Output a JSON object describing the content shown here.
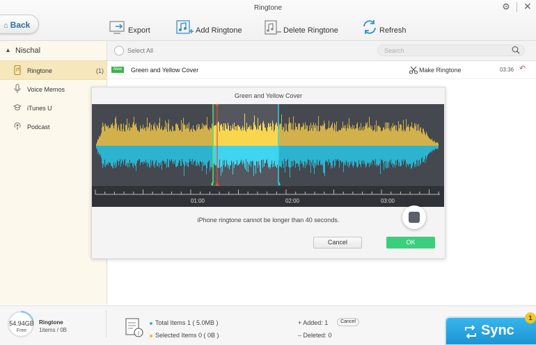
{
  "window": {
    "title": "Ringtone"
  },
  "toolbar": {
    "back_label": "Back",
    "export_label": "Export",
    "add_ringtone_label": "Add Ringtone",
    "delete_ringtone_label": "Delete Ringtone",
    "refresh_label": "Refresh"
  },
  "sidebar": {
    "device_name": "Nischal",
    "items": [
      {
        "label": "Ringtone",
        "count": "(1)",
        "icon": "phone-icon",
        "active": true
      },
      {
        "label": "Voice Memos",
        "count": "",
        "icon": "microphone-icon",
        "active": false
      },
      {
        "label": "iTunes U",
        "count": "",
        "icon": "graduation-cap-icon",
        "active": false
      },
      {
        "label": "Podcast",
        "count": "",
        "icon": "podcast-icon",
        "active": false
      }
    ]
  },
  "list": {
    "select_all_label": "Select All",
    "search_placeholder": "Search",
    "rows": [
      {
        "badge": "New",
        "title": "Green and Yellow Cover",
        "action_label": "Make Ringtone",
        "duration": "03:36"
      }
    ]
  },
  "dialog": {
    "title": "Green and Yellow Cover",
    "message": "iPhone ringtone cannot be longer than 40 seconds.",
    "cancel_label": "Cancel",
    "ok_label": "OK",
    "timeline_labels": [
      "01:00",
      "02:00",
      "03:00"
    ],
    "colors": {
      "wave_top": "#d3b14a",
      "wave_top_selected": "#f8d74e",
      "wave_bottom": "#2bb3cf",
      "wave_bottom_selected": "#3fd4f0",
      "start_marker": "#5bdc6a",
      "playhead": "#e0503e",
      "end_marker": "#2fd0e6"
    }
  },
  "footer": {
    "storage_size": "54.94GB",
    "storage_free_label": "Free",
    "category": "Ringtone",
    "category_count": "1items / 0B",
    "total_items": "Total Items 1 ( 5.0MB )",
    "selected_items": "Selected Items 0 ( 0B )",
    "added": "Added: 1",
    "added_cancel_label": "Cancel",
    "deleted": "Deleted: 0",
    "sync_label": "Sync",
    "sync_badge": "1"
  }
}
